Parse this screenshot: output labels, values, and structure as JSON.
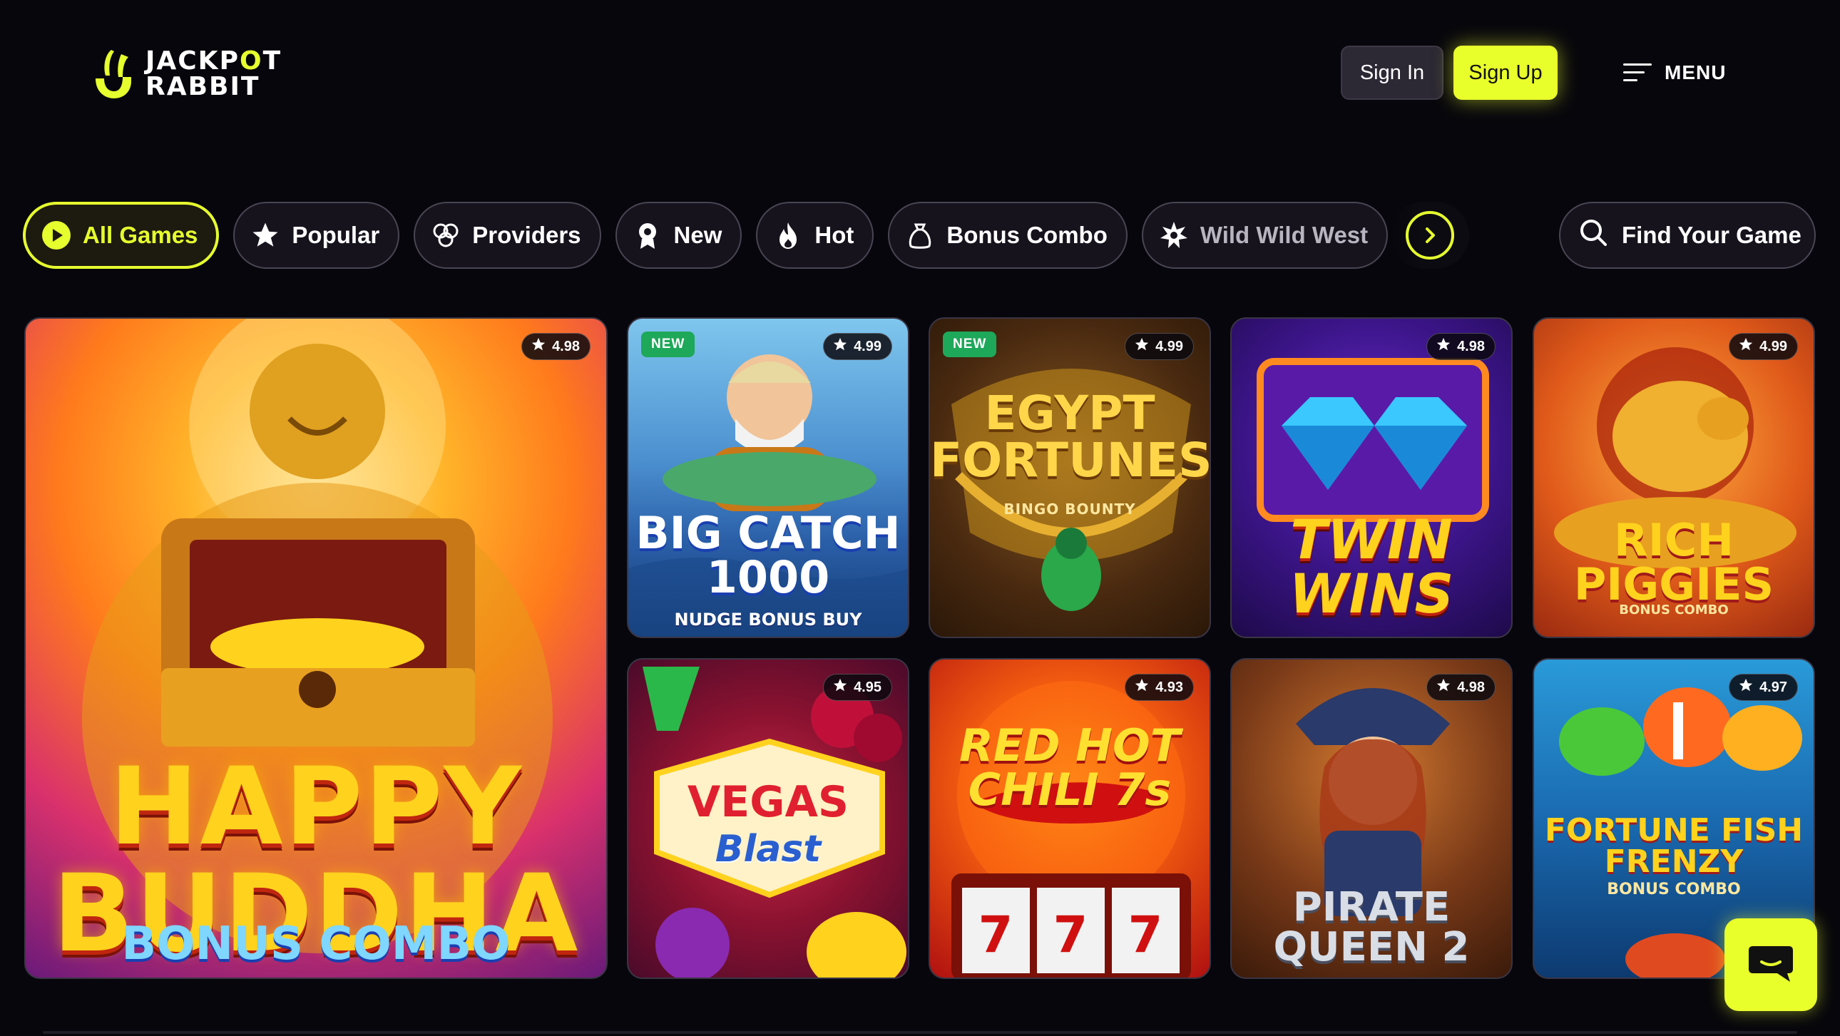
{
  "brand": {
    "line1_a": "JACKP",
    "line1_o": "O",
    "line1_b": "T",
    "line2": "RABBIT",
    "accent": "#e6ff2e"
  },
  "header": {
    "sign_in": "Sign In",
    "sign_up": "Sign Up",
    "menu": "MENU"
  },
  "categories": [
    {
      "label": "All Games",
      "icon": "play-icon",
      "active": true
    },
    {
      "label": "Popular",
      "icon": "star-icon"
    },
    {
      "label": "Providers",
      "icon": "providers-icon"
    },
    {
      "label": "New",
      "icon": "badge-icon"
    },
    {
      "label": "Hot",
      "icon": "flame-icon"
    },
    {
      "label": "Bonus Combo",
      "icon": "money-bag-icon"
    },
    {
      "label": "Wild Wild West",
      "icon": "sheriff-star-icon"
    }
  ],
  "search": {
    "label": "Find Your Game"
  },
  "games": [
    {
      "title_1": "HAPPY",
      "title_2": "BUDDHA",
      "subtitle": "BONUS COMBO",
      "rating": "4.98",
      "is_new": false
    },
    {
      "title_1": "BIG CATCH",
      "title_2": "1000",
      "subtitle": "NUDGE BONUS BUY",
      "rating": "4.99",
      "is_new": true,
      "new_label": "NEW"
    },
    {
      "title_1": "EGYPT",
      "title_2": "FORTUNES",
      "subtitle": "BINGO BOUNTY",
      "rating": "4.99",
      "is_new": true,
      "new_label": "NEW"
    },
    {
      "title_1": "TWIN",
      "title_2": "WINS",
      "subtitle": "",
      "rating": "4.98",
      "is_new": false
    },
    {
      "title_1": "RICH",
      "title_2": "PIGGIES",
      "subtitle": "BONUS COMBO",
      "rating": "4.99",
      "is_new": false
    },
    {
      "title_1": "VEGAS",
      "title_2": "Blast",
      "subtitle": "",
      "rating": "4.95",
      "is_new": false
    },
    {
      "title_1": "RED HOT",
      "title_2": "CHILI 7s",
      "subtitle": "",
      "rating": "4.93",
      "is_new": false
    },
    {
      "title_1": "PIRATE",
      "title_2": "QUEEN 2",
      "subtitle": "",
      "rating": "4.98",
      "is_new": false
    },
    {
      "title_1": "FORTUNE FISH",
      "title_2": "FRENZY",
      "subtitle": "BONUS COMBO",
      "rating": "4.97",
      "is_new": false
    }
  ]
}
